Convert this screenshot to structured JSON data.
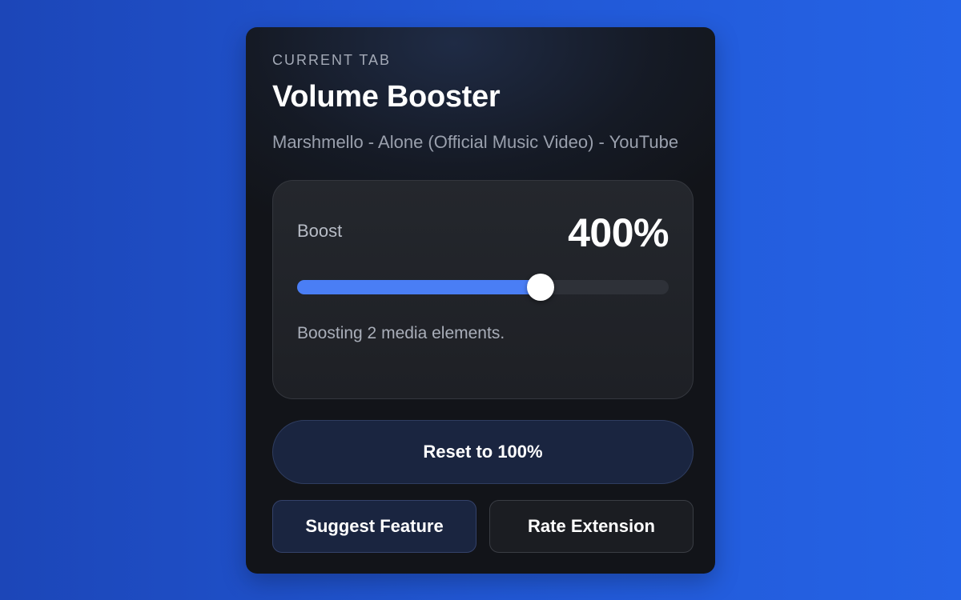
{
  "header": {
    "eyebrow": "CURRENT TAB",
    "title": "Volume Booster",
    "tab_title": "Marshmello - Alone (Official Music Video) - YouTube"
  },
  "boost": {
    "label": "Boost",
    "value_text": "400%",
    "slider_fraction": 0.655,
    "status": "Boosting 2 media elements."
  },
  "actions": {
    "reset_label": "Reset to 100%",
    "suggest_label": "Suggest Feature",
    "rate_label": "Rate Extension"
  },
  "colors": {
    "accent": "#4a7ef5",
    "background_start": "#1c46b8",
    "background_end": "#2563e6",
    "panel": "#151a25"
  }
}
